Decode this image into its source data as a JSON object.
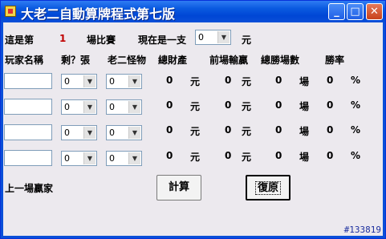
{
  "window": {
    "title": "大老二自動算牌程式第七版",
    "minimize": "_",
    "maximize": "□",
    "close": "✕"
  },
  "top": {
    "game_label_prefix": "這是第",
    "game_number": "1",
    "game_label_suffix": "場比賽",
    "per_unit_label": "現在是一支",
    "unit_value": "0",
    "unit_suffix": "元"
  },
  "headers": [
    "玩家名稱",
    "剩？張",
    "老二怪物",
    "總財產",
    "前場輸贏",
    "總勝場數",
    "勝率"
  ],
  "players": [
    {
      "remaining": "0",
      "twos": "0",
      "total": "0",
      "total_unit": "元",
      "last": "0",
      "last_unit": "元",
      "wins": "0",
      "wins_unit": "場",
      "rate": "0",
      "rate_unit": "%"
    },
    {
      "remaining": "0",
      "twos": "0",
      "total": "0",
      "total_unit": "元",
      "last": "0",
      "last_unit": "元",
      "wins": "0",
      "wins_unit": "場",
      "rate": "0",
      "rate_unit": "%"
    },
    {
      "remaining": "0",
      "twos": "0",
      "total": "0",
      "total_unit": "元",
      "last": "0",
      "last_unit": "元",
      "wins": "0",
      "wins_unit": "場",
      "rate": "0",
      "rate_unit": "%"
    },
    {
      "remaining": "0",
      "twos": "0",
      "total": "0",
      "total_unit": "元",
      "last": "0",
      "last_unit": "元",
      "wins": "0",
      "wins_unit": "場",
      "rate": "0",
      "rate_unit": "%"
    }
  ],
  "footer": {
    "last_winner_label": "上一場贏家",
    "calc_button": "計算",
    "restore_button": "復原",
    "corner_id": "#133819"
  },
  "colors": {
    "title_bar": "#0a5ae0",
    "client_bg": "#ece9ee",
    "game_number": "#c00000"
  }
}
